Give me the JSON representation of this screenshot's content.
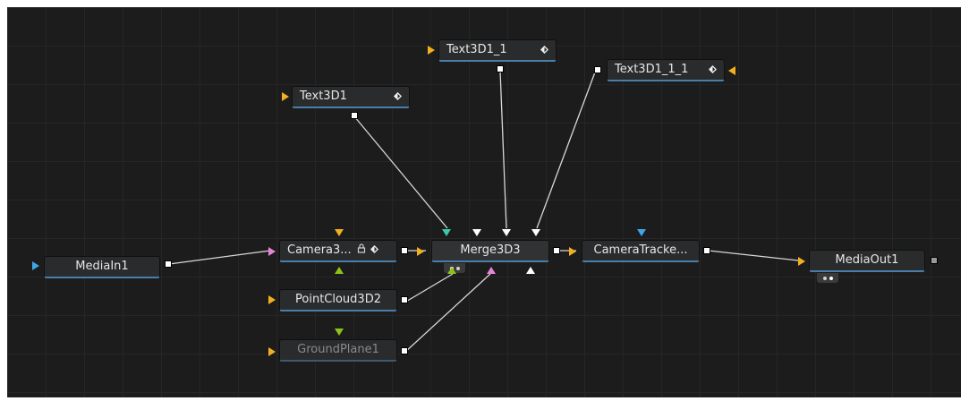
{
  "colors": {
    "background": "#1c1c1c",
    "grid": "#262626",
    "node": "#2a2b2c",
    "node_accent": "#4a7ea8",
    "input_yellow": "#f2b01e",
    "input_blue": "#3ea6e8",
    "input_pink": "#e882d8",
    "input_green": "#8cc21a",
    "input_teal": "#3cc8a8",
    "wire": "#d8d8d8"
  },
  "nodes": {
    "media_in": {
      "label": "MediaIn1"
    },
    "camera3d": {
      "label": "Camera3..."
    },
    "merge3d": {
      "label": "Merge3D3"
    },
    "camera_tracker": {
      "label": "CameraTracke..."
    },
    "media_out": {
      "label": "MediaOut1"
    },
    "text3d1": {
      "label": "Text3D1"
    },
    "text3d1_1": {
      "label": "Text3D1_1"
    },
    "text3d1_1_1": {
      "label": "Text3D1_1_1"
    },
    "pointcloud": {
      "label": "PointCloud3D2"
    },
    "groundplane": {
      "label": "GroundPlane1"
    }
  },
  "icons": {
    "lock": "🔒",
    "diamond": "◆",
    "lock_glyph": "⌂",
    "diamond_glyph": "◈"
  }
}
